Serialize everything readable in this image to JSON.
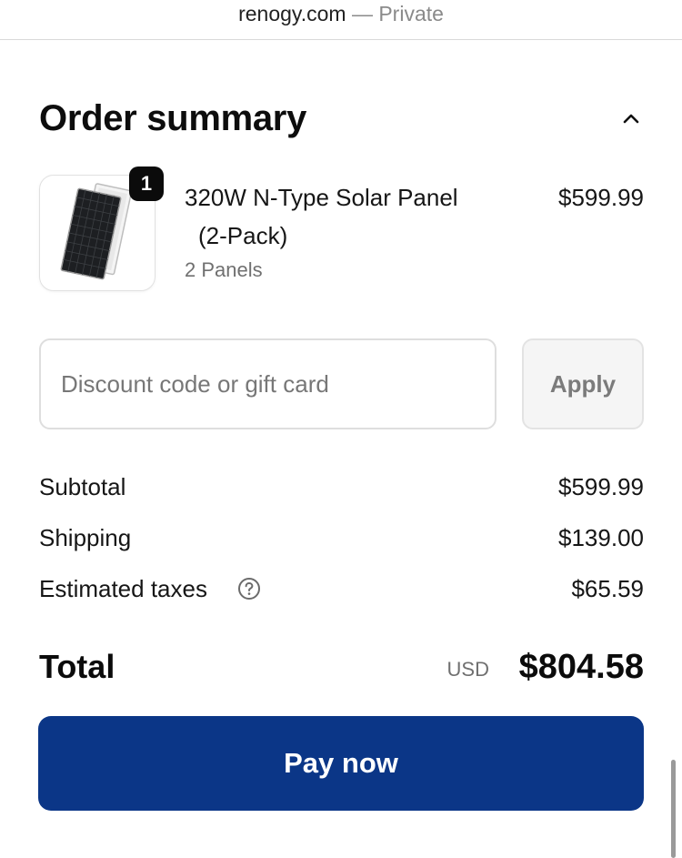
{
  "browser": {
    "host": "renogy.com",
    "separator": "—",
    "mode": "Private"
  },
  "order_summary": {
    "title": "Order summary",
    "toggle_icon": "chevron-up-icon",
    "item": {
      "quantity": "1",
      "name_line1": "320W N-Type Solar Panel",
      "name_line2": "(2-Pack)",
      "variant": "2 Panels",
      "price": "$599.99",
      "image_icon": "solar-panel-image"
    },
    "discount": {
      "placeholder": "Discount code or gift card",
      "value": "",
      "apply_label": "Apply"
    },
    "costs": {
      "subtotal_label": "Subtotal",
      "subtotal_value": "$599.99",
      "shipping_label": "Shipping",
      "shipping_value": "$139.00",
      "taxes_label": "Estimated taxes",
      "taxes_icon": "question-circle-icon",
      "taxes_value": "$65.59"
    },
    "total": {
      "label": "Total",
      "currency": "USD",
      "amount": "$804.58"
    },
    "pay_label": "Pay now"
  },
  "colors": {
    "pay_button": "#0b3687",
    "badge": "#0b0b0b",
    "muted_text": "#707070",
    "border": "#dedede"
  }
}
